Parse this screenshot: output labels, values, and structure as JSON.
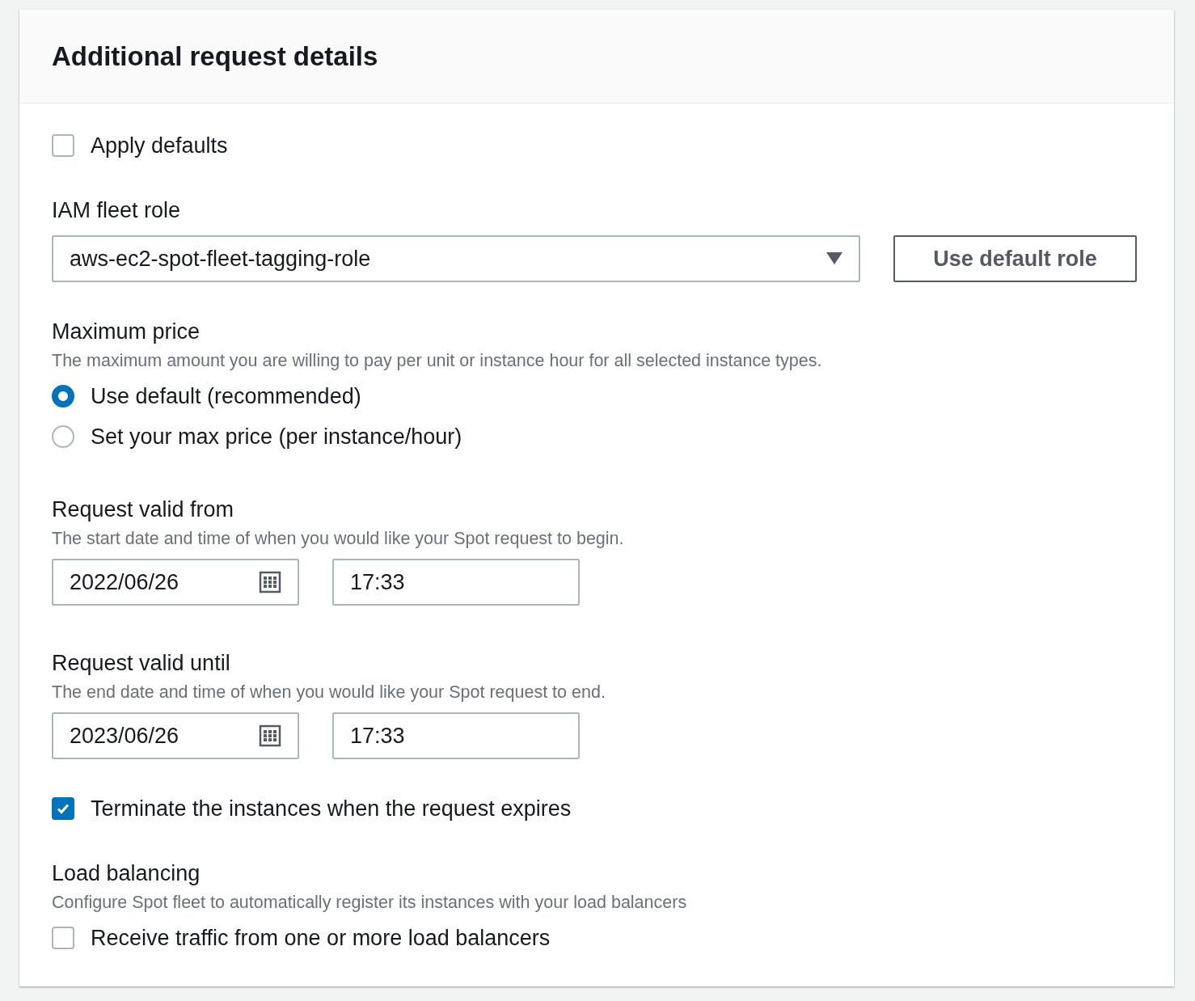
{
  "panel": {
    "title": "Additional request details"
  },
  "apply_defaults": {
    "label": "Apply defaults",
    "checked": false
  },
  "iam_role": {
    "label": "IAM fleet role",
    "value": "aws-ec2-spot-fleet-tagging-role",
    "button": "Use default role"
  },
  "max_price": {
    "label": "Maximum price",
    "description": "The maximum amount you are willing to pay per unit or instance hour for all selected instance types.",
    "options": [
      {
        "label": "Use default (recommended)",
        "selected": true
      },
      {
        "label": "Set your max price (per instance/hour)",
        "selected": false
      }
    ]
  },
  "valid_from": {
    "label": "Request valid from",
    "description": "The start date and time of when you would like your Spot request to begin.",
    "date": "2022/06/26",
    "time": "17:33"
  },
  "valid_until": {
    "label": "Request valid until",
    "description": "The end date and time of when you would like your Spot request to end.",
    "date": "2023/06/26",
    "time": "17:33"
  },
  "terminate": {
    "label": "Terminate the instances when the request expires",
    "checked": true
  },
  "load_balancing": {
    "label": "Load balancing",
    "description": "Configure Spot fleet to automatically register its instances with your load balancers",
    "option": {
      "label": "Receive traffic from one or more load balancers",
      "checked": false
    }
  }
}
